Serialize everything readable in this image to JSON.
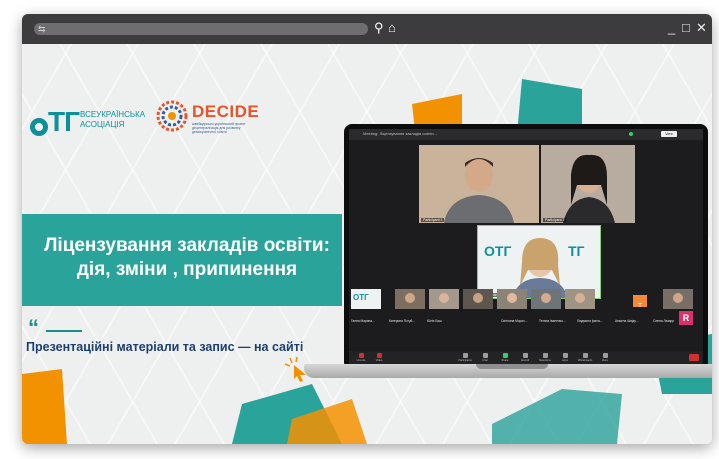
{
  "browser": {
    "nav_icons": [
      "search-icon",
      "home-icon"
    ],
    "window_controls": [
      "_",
      "□",
      "✕"
    ]
  },
  "logos": {
    "otg": {
      "mark": "ОТГ",
      "line1": "ВСЕУКРАЇНСЬКА",
      "line2": "АСОЦІАЦІЯ"
    },
    "decide": {
      "name": "DECIDE",
      "tagline": "швейцарсько-український проект децентралізація для розвитку демократичної освіти"
    }
  },
  "slide": {
    "title_line1": "Ліцензування закладів освіти:",
    "title_line2": "дія, зміни , припинення",
    "subtitle": "Презентаційні матеріали та запис — на сайті"
  },
  "zoom": {
    "meeting_title": "Meeting: Ліцензування закладів освіти...",
    "view_label": "View",
    "participants": [
      {
        "name": "Participant 1"
      },
      {
        "name": "Participant 2"
      },
      {
        "name": "Participant 3"
      }
    ],
    "strip_names": [
      "Ганна Марина...",
      "Катерина Погуй...",
      "Юлія Баш",
      "Світлана Морох...",
      "Тетяна Іваненко...",
      "Людмила Ірина...",
      "Анжела Швідч...",
      "Олена Лазарр"
    ],
    "toolbar": [
      "Unmute",
      "Video",
      "Participants",
      "Chat",
      "Share",
      "Record",
      "Reactions",
      "Apps",
      "Whiteboards",
      "More"
    ],
    "highlight_letter": "R",
    "badge_letter": "T"
  },
  "colors": {
    "teal": "#2aa39a",
    "orange": "#f39200",
    "navy": "#1d3e6e",
    "decide_orange": "#e8542a"
  }
}
